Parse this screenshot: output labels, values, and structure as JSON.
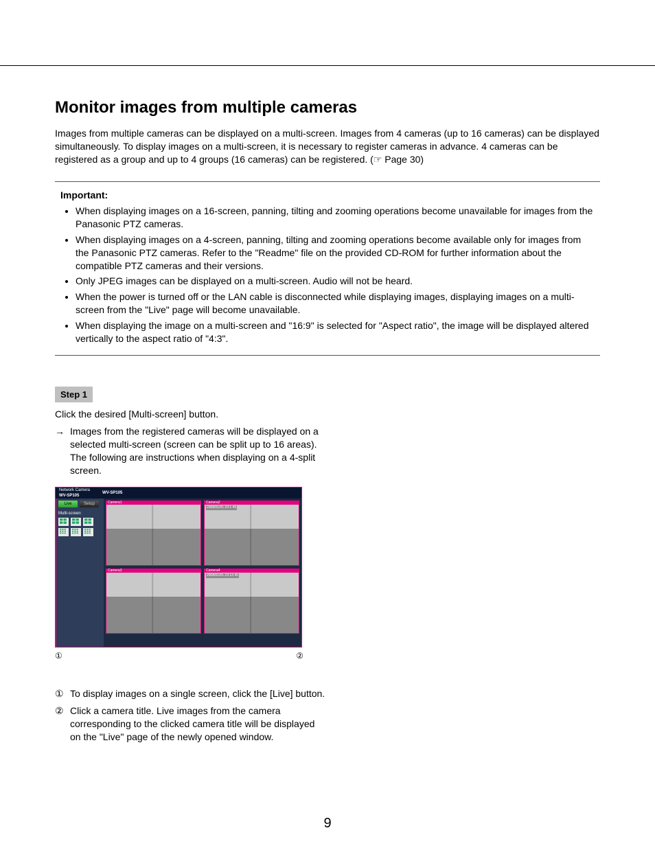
{
  "title": "Monitor images from multiple cameras",
  "intro": "Images from multiple cameras can be displayed on a multi-screen. Images from 4 cameras (up to 16 cameras) can be displayed simultaneously. To display images on a multi-screen, it is necessary to register cameras in advance. 4 cameras can be registered as a group and up to 4 groups (16 cameras) can be registered. (☞ Page 30)",
  "important": {
    "heading": "Important:",
    "items": [
      "When displaying images on a 16-screen, panning, tilting and zooming operations become unavailable for images from the Panasonic PTZ cameras.",
      "When displaying images on a 4-screen, panning, tilting and zooming operations become available only for images from the Panasonic PTZ cameras. Refer to the \"Readme\" file on the provided CD-ROM for further information about the compatible PTZ cameras and their versions.",
      "Only JPEG images can be displayed on a multi-screen. Audio will not be heard.",
      "When the power is turned off or the LAN cable is disconnected while displaying images, displaying images on a multi-screen from the \"Live\" page will become unavailable.",
      "When displaying the image on a multi-screen and \"16:9\" is selected for \"Aspect ratio\", the image will be displayed altered vertically to the aspect ratio of \"4:3\"."
    ]
  },
  "step": {
    "label": "Step 1",
    "text": "Click the desired [Multi-screen] button.",
    "arrow_text": "Images from the registered cameras will be displayed on a selected multi-screen (screen can be split up to 16 areas). The following are instructions when displaying on a 4-split screen."
  },
  "screenshot": {
    "header_label": "Network Camera",
    "model1": "WV-SP105",
    "model2": "WV-SP105",
    "live_btn": "Live",
    "setup_btn": "Setup",
    "multiscreen_label": "Multi-screen",
    "cameras": [
      {
        "title": "Camera1",
        "ts": ""
      },
      {
        "title": "Camera2",
        "ts": "2008/01/01 23:1  45"
      },
      {
        "title": "Camera3",
        "ts": ""
      },
      {
        "title": "Camera4",
        "ts": "2008/01/01 23:13 45"
      }
    ]
  },
  "callouts": {
    "left": "①",
    "right": "②"
  },
  "numbered": [
    {
      "n": "①",
      "t": "To display images on a single screen, click the [Live] button."
    },
    {
      "n": "②",
      "t": "Click a camera title. Live images from the camera corresponding to the clicked camera title will be displayed on the \"Live\" page of the newly opened window."
    }
  ],
  "page_number": "9"
}
